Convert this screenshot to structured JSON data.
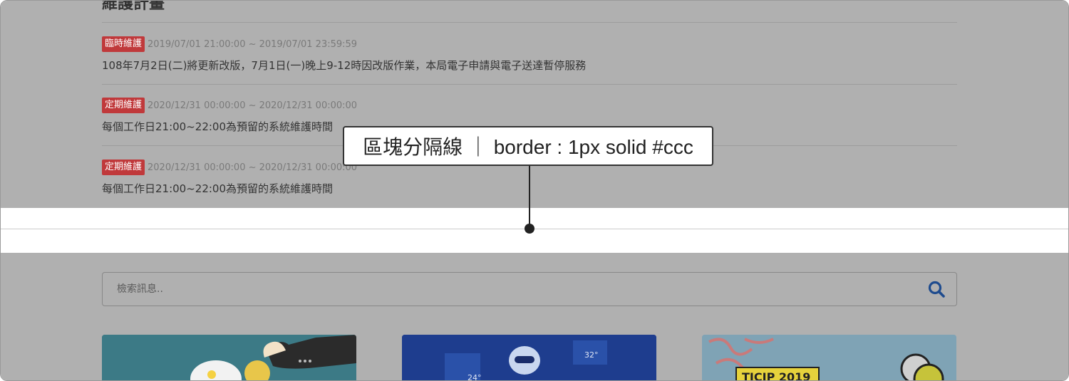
{
  "section": {
    "title": "維護計畫"
  },
  "maintenance_items": [
    {
      "badge": "臨時維護",
      "time": "2019/07/01 21:00:00 ~ 2019/07/01 23:59:59",
      "description": "108年7月2日(二)將更新改版，7月1日(一)晚上9-12時因改版作業，本局電子申請與電子送達暫停服務"
    },
    {
      "badge": "定期維護",
      "time": "2020/12/31 00:00:00 ~ 2020/12/31 00:00:00",
      "description": "每個工作日21:00~22:00為預留的系統維護時間"
    },
    {
      "badge": "定期維護",
      "time": "2020/12/31 00:00:00 ~ 2020/12/31 00:00:00",
      "description": "每個工作日21:00~22:00為預留的系統維護時間"
    }
  ],
  "annotation": {
    "text": "區塊分隔線 ｜ border : 1px solid #ccc"
  },
  "search": {
    "placeholder": "檢索訊息.."
  },
  "cards": [
    {
      "label": ""
    },
    {
      "label": "24° 32°"
    },
    {
      "label": "TICIP 2019"
    }
  ],
  "colors": {
    "overlay": "#b0b0b0",
    "badge": "#c0393b",
    "separator": "#cccccc",
    "search_icon": "#1e4b8e"
  }
}
